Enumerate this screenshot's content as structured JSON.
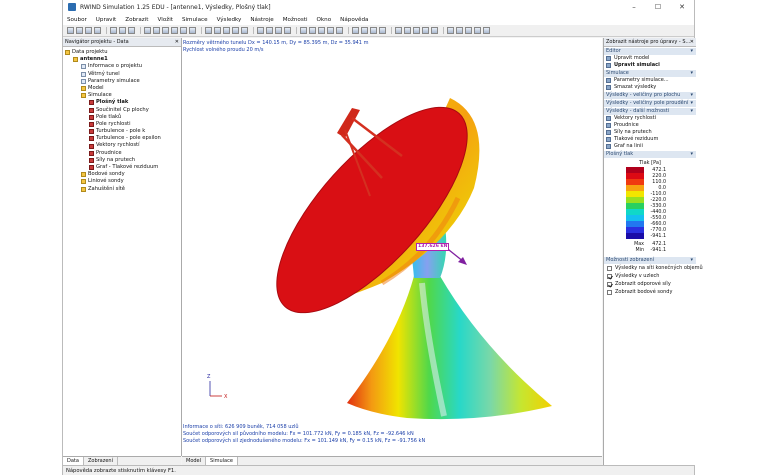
{
  "window": {
    "title": "RWIND Simulation 1.25 EDU - [antenne1, Výsledky, Plošný tlak]",
    "controls": {
      "minimize": "–",
      "maximize": "☐",
      "close": "✕"
    }
  },
  "menu": [
    "Soubor",
    "Upravit",
    "Zobrazit",
    "Vložit",
    "Simulace",
    "Výsledky",
    "Nástroje",
    "Možnosti",
    "Okno",
    "Nápověda"
  ],
  "navigator": {
    "title": "Navigátor projektu - Data",
    "items": [
      {
        "label": "Data projektu",
        "level": 0,
        "icon": "folder-icon"
      },
      {
        "label": "antenne1",
        "level": 1,
        "icon": "folder-icon",
        "bold": true
      },
      {
        "label": "Informace o projektu",
        "level": 2,
        "icon": "doc-icon"
      },
      {
        "label": "Větrný tunel",
        "level": 2,
        "icon": "doc-icon"
      },
      {
        "label": "Parametry simulace",
        "level": 2,
        "icon": "doc-icon"
      },
      {
        "label": "Model",
        "level": 2,
        "icon": "folder-icon"
      },
      {
        "label": "Simulace",
        "level": 2,
        "icon": "folder-icon"
      },
      {
        "label": "Plošný tlak",
        "level": 3,
        "icon": "result-icon",
        "bold": true
      },
      {
        "label": "Součinitel Cp plochy",
        "level": 3,
        "icon": "result-icon"
      },
      {
        "label": "Pole tlaků",
        "level": 3,
        "icon": "result-icon"
      },
      {
        "label": "Pole rychlosti",
        "level": 3,
        "icon": "result-icon"
      },
      {
        "label": "Turbulence - pole k",
        "level": 3,
        "icon": "result-icon"
      },
      {
        "label": "Turbulence - pole epsilon",
        "level": 3,
        "icon": "result-icon"
      },
      {
        "label": "Vektory rychlostí",
        "level": 3,
        "icon": "result-icon"
      },
      {
        "label": "Proudnice",
        "level": 3,
        "icon": "result-icon"
      },
      {
        "label": "Síly na prutech",
        "level": 3,
        "icon": "result-icon"
      },
      {
        "label": "Graf - Tlakové reziduum",
        "level": 3,
        "icon": "result-icon"
      },
      {
        "label": "Bodové sondy",
        "level": 2,
        "icon": "folder-icon"
      },
      {
        "label": "Liniové sondy",
        "level": 2,
        "icon": "folder-icon"
      },
      {
        "label": "Zahuštění sítě",
        "level": 2,
        "icon": "folder-icon"
      }
    ],
    "tabs": [
      "Data",
      "Zobrazení"
    ]
  },
  "viewport": {
    "info_top": [
      "Rozměry větrného tunelu Dx = 140.15 m, Dy = 85.395 m, Dz = 35.941 m",
      "Rychlost volného proudu 20 m/s"
    ],
    "force_label": "137.626 kN",
    "axis": {
      "x": "X",
      "z": "Z"
    },
    "info_bottom": [
      "Informace o síti: 626 909 buněk, 714 058 uzlů",
      "Součet odporových sil původního modelu: Fx = 101.772 kN, Fy = 0.185 kN, Fz = -92.646 kN",
      "Součet odporových sil zjednodušeného modelu: Fx = 101.149 kN, Fy = 0.15 kN, Fz = -91.756 kN"
    ],
    "tabs": [
      "Model",
      "Simulace"
    ]
  },
  "right_panel": {
    "title": "Zobrazit nástroje pro úpravy - S...",
    "sections": [
      {
        "title": "Editor",
        "items": [
          {
            "label": "Upravit model",
            "bold": false
          },
          {
            "label": "Upravit simulaci",
            "bold": true
          }
        ]
      },
      {
        "title": "Simulace",
        "items": [
          {
            "label": "Parametry simulace...",
            "bold": false
          },
          {
            "label": "Smazat výsledky",
            "bold": false
          }
        ]
      },
      {
        "title": "Výsledky - veličiny pro plochu",
        "items": []
      },
      {
        "title": "Výsledky - veličiny pole proudění",
        "items": []
      },
      {
        "title": "Výsledky - další možnosti",
        "items": [
          {
            "label": "Vektory rychlostí",
            "bold": false
          },
          {
            "label": "Proudnice",
            "bold": false
          },
          {
            "label": "Síly na prutech",
            "bold": false
          },
          {
            "label": "Tlakové reziduum",
            "bold": false
          },
          {
            "label": "Graf na linii",
            "bold": false
          }
        ]
      }
    ],
    "legend_section": "Plošný tlak",
    "legend_title": "Tlak [Pa]",
    "legend": [
      {
        "value": "472.1",
        "color": "#b0001c"
      },
      {
        "value": "220.0",
        "color": "#dd0a14"
      },
      {
        "value": "110.0",
        "color": "#f03a10"
      },
      {
        "value": "0.0",
        "color": "#f7a310"
      },
      {
        "value": "-110.0",
        "color": "#f2e600"
      },
      {
        "value": "-220.0",
        "color": "#98e020"
      },
      {
        "value": "-330.0",
        "color": "#28d060"
      },
      {
        "value": "-440.0",
        "color": "#10d8c8"
      },
      {
        "value": "-550.0",
        "color": "#14c0f0"
      },
      {
        "value": "-660.0",
        "color": "#2278f0"
      },
      {
        "value": "-770.0",
        "color": "#2a30e0"
      },
      {
        "value": "-941.1",
        "color": "#1a0ca8"
      }
    ],
    "legend_max_label": "Max",
    "legend_max": "472.1",
    "legend_min_label": "Min",
    "legend_min": "-941.1",
    "options_section": "Možnosti zobrazení",
    "options": [
      {
        "label": "Výsledky na síti konečných objemů",
        "checked": false
      },
      {
        "label": "Výsledky v uzlech",
        "checked": true
      },
      {
        "label": "Zobrazit odporové síly",
        "checked": true
      },
      {
        "label": "Zobrazit bodové sondy",
        "checked": false
      }
    ]
  },
  "status": "Nápověda zobrazte stisknutím klávesy F1."
}
